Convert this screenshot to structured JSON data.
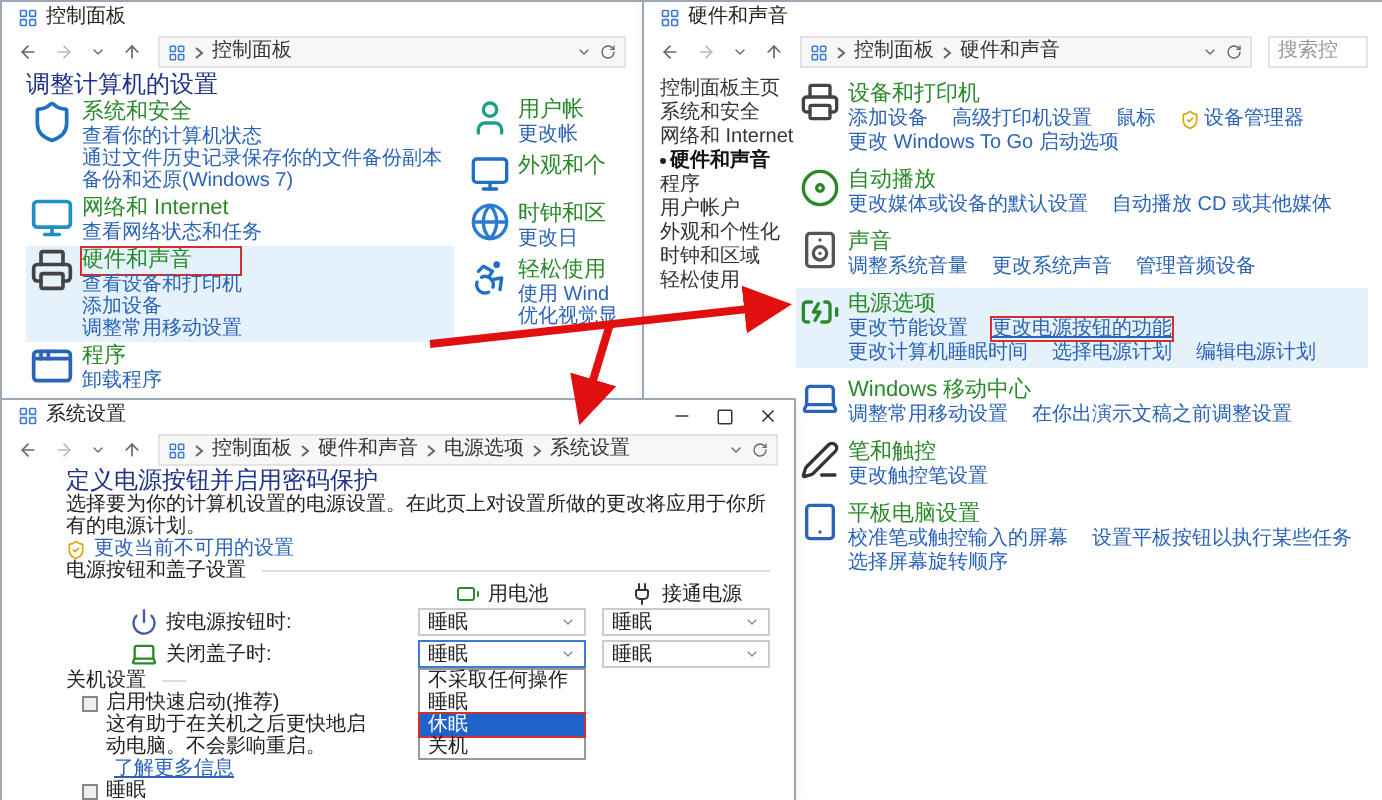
{
  "control_panel": {
    "title": "控制面板",
    "breadcrumb": [
      "控制面板"
    ],
    "heading": "调整计算机的设置",
    "categories": [
      {
        "kind": "security",
        "title": "系统和安全",
        "selected": false,
        "annotated": false,
        "links": [
          "查看你的计算机状态",
          "通过文件历史记录保存你的文件备份副本",
          "备份和还原(Windows 7)"
        ]
      },
      {
        "kind": "network",
        "title": "网络和 Internet",
        "selected": false,
        "annotated": false,
        "links": [
          "查看网络状态和任务"
        ]
      },
      {
        "kind": "hardware",
        "title": "硬件和声音",
        "selected": true,
        "annotated": true,
        "links": [
          "查看设备和打印机",
          "添加设备",
          "调整常用移动设置"
        ]
      },
      {
        "kind": "programs",
        "title": "程序",
        "selected": false,
        "annotated": false,
        "links": [
          "卸载程序"
        ]
      }
    ],
    "categories_right": [
      {
        "kind": "users",
        "title": "用户帐",
        "links": [
          "更改帐"
        ]
      },
      {
        "kind": "appearance",
        "title": "外观和个"
      },
      {
        "kind": "clock",
        "title": "时钟和区",
        "links": [
          "更改日"
        ]
      },
      {
        "kind": "ease",
        "title": "轻松使用",
        "links": [
          "使用 Wind",
          "优化视觉显"
        ]
      }
    ]
  },
  "hardware_and_sound": {
    "title": "硬件和声音",
    "breadcrumb": [
      "控制面板",
      "硬件和声音"
    ],
    "search": {
      "placeholder": "搜索控"
    },
    "sidebar": [
      {
        "label": "控制面板主页",
        "selected": false
      },
      {
        "label": "系统和安全",
        "selected": false
      },
      {
        "label": "网络和 Internet",
        "selected": false
      },
      {
        "label": "硬件和声音",
        "selected": true
      },
      {
        "label": "程序",
        "selected": false
      },
      {
        "label": "用户帐户",
        "selected": false
      },
      {
        "label": "外观和个性化",
        "selected": false
      },
      {
        "label": "时钟和区域",
        "selected": false
      },
      {
        "label": "轻松使用",
        "selected": false
      }
    ],
    "categories": [
      {
        "kind": "devices",
        "title": "设备和打印机",
        "selected": false,
        "links": [
          {
            "text": "添加设备",
            "kind": "link",
            "annotated": false
          },
          {
            "text": "高级打印机设置",
            "kind": "link",
            "annotated": false
          },
          {
            "text": "鼠标",
            "kind": "link",
            "annotated": false
          },
          {
            "text": "设备管理器",
            "kind": "shield",
            "annotated": false
          },
          {
            "text": "更改 Windows To Go 启动选项",
            "kind": "link",
            "annotated": false
          }
        ]
      },
      {
        "kind": "autoplay",
        "title": "自动播放",
        "selected": false,
        "links": [
          {
            "text": "更改媒体或设备的默认设置",
            "kind": "link",
            "annotated": false
          },
          {
            "text": "自动播放 CD 或其他媒体",
            "kind": "link",
            "annotated": false
          }
        ]
      },
      {
        "kind": "sound",
        "title": "声音",
        "selected": false,
        "links": [
          {
            "text": "调整系统音量",
            "kind": "link",
            "annotated": false
          },
          {
            "text": "更改系统声音",
            "kind": "link",
            "annotated": false
          },
          {
            "text": "管理音频设备",
            "kind": "link",
            "annotated": false
          }
        ]
      },
      {
        "kind": "power",
        "title": "电源选项",
        "selected": true,
        "links": [
          {
            "text": "更改节能设置",
            "kind": "link",
            "annotated": false
          },
          {
            "text": "更改电源按钮的功能",
            "kind": "link",
            "annotated": true
          },
          {
            "text": "更改计算机睡眠时间",
            "kind": "link",
            "annotated": false
          },
          {
            "text": "选择电源计划",
            "kind": "link",
            "annotated": false
          },
          {
            "text": "编辑电源计划",
            "kind": "link",
            "annotated": false
          }
        ]
      },
      {
        "kind": "mobility",
        "title": "Windows 移动中心",
        "selected": false,
        "links": [
          {
            "text": "调整常用移动设置",
            "kind": "link",
            "annotated": false
          },
          {
            "text": "在你出演示文稿之前调整设置",
            "kind": "link",
            "annotated": false
          }
        ]
      },
      {
        "kind": "pen",
        "title": "笔和触控",
        "selected": false,
        "links": [
          {
            "text": "更改触控笔设置",
            "kind": "link",
            "annotated": false
          }
        ]
      },
      {
        "kind": "tablet",
        "title": "平板电脑设置",
        "selected": false,
        "links": [
          {
            "text": "校准笔或触控输入的屏幕",
            "kind": "link",
            "annotated": false
          },
          {
            "text": "设置平板按钮以执行某些任务",
            "kind": "link",
            "annotated": false
          },
          {
            "text": "选择屏幕旋转顺序",
            "kind": "link",
            "annotated": false
          }
        ]
      }
    ]
  },
  "system_settings": {
    "title": "系统设置",
    "breadcrumb": [
      "控制面板",
      "硬件和声音",
      "电源选项",
      "系统设置"
    ],
    "heading": "定义电源按钮并启用密码保护",
    "description": "选择要为你的计算机设置的电源设置。在此页上对设置所做的更改将应用于你所有的电源计划。",
    "settings_link": "更改当前不可用的设置",
    "power_section": "电源按钮和盖子设置",
    "columns": [
      {
        "kind": "battery",
        "label": "用电池"
      },
      {
        "kind": "plugged",
        "label": "接通电源"
      }
    ],
    "rows": [
      {
        "kind": "power-button",
        "label": "按电源按钮时:",
        "values": [
          {
            "text": "睡眠",
            "open": false
          },
          {
            "text": "睡眠",
            "open": false
          }
        ]
      },
      {
        "kind": "lid",
        "label": "关闭盖子时:",
        "values": [
          {
            "text": "睡眠",
            "open": true
          },
          {
            "text": "睡眠",
            "open": false
          }
        ]
      }
    ],
    "dropdown_options": [
      {
        "text": "不采取任何操作",
        "selected": false,
        "annotated": false
      },
      {
        "text": "睡眠",
        "selected": false,
        "annotated": false
      },
      {
        "text": "休眠",
        "selected": true,
        "annotated": true
      },
      {
        "text": "关机",
        "selected": false,
        "annotated": false
      }
    ],
    "shutdown_section": "关机设置",
    "options": [
      {
        "label": "启用快速启动(推荐)",
        "checked": false,
        "note": "这有助于在关机之后更快地启动电脑。不会影响重启。",
        "link": "了解更多信息"
      },
      {
        "label": "睡眠",
        "checked": false
      }
    ]
  }
}
